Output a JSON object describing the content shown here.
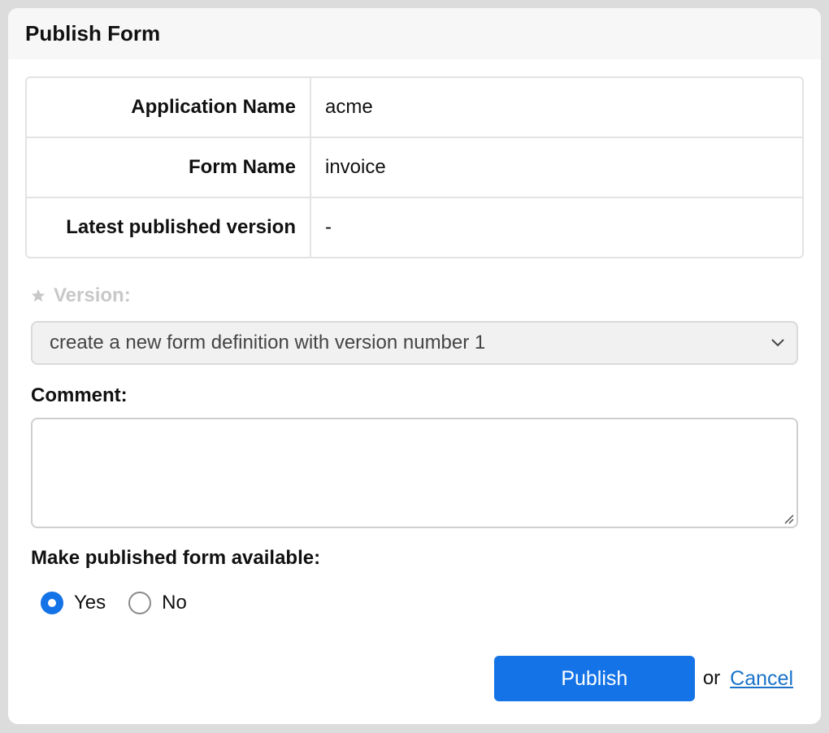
{
  "dialog": {
    "title": "Publish Form"
  },
  "info": {
    "rows": [
      {
        "label": "Application Name",
        "value": "acme"
      },
      {
        "label": "Form Name",
        "value": "invoice"
      },
      {
        "label": "Latest published version",
        "value": "-"
      }
    ]
  },
  "version": {
    "label": "Version:",
    "selected": "create a new form definition with version number 1",
    "icon": "star-icon"
  },
  "comment": {
    "label": "Comment:",
    "value": ""
  },
  "availability": {
    "label": "Make published form available:",
    "options": [
      {
        "label": "Yes",
        "checked": true
      },
      {
        "label": "No",
        "checked": false
      }
    ]
  },
  "footer": {
    "publish_label": "Publish",
    "or_text": "or",
    "cancel_label": "Cancel"
  },
  "colors": {
    "accent": "#1473e6",
    "link": "#1a73c9"
  }
}
